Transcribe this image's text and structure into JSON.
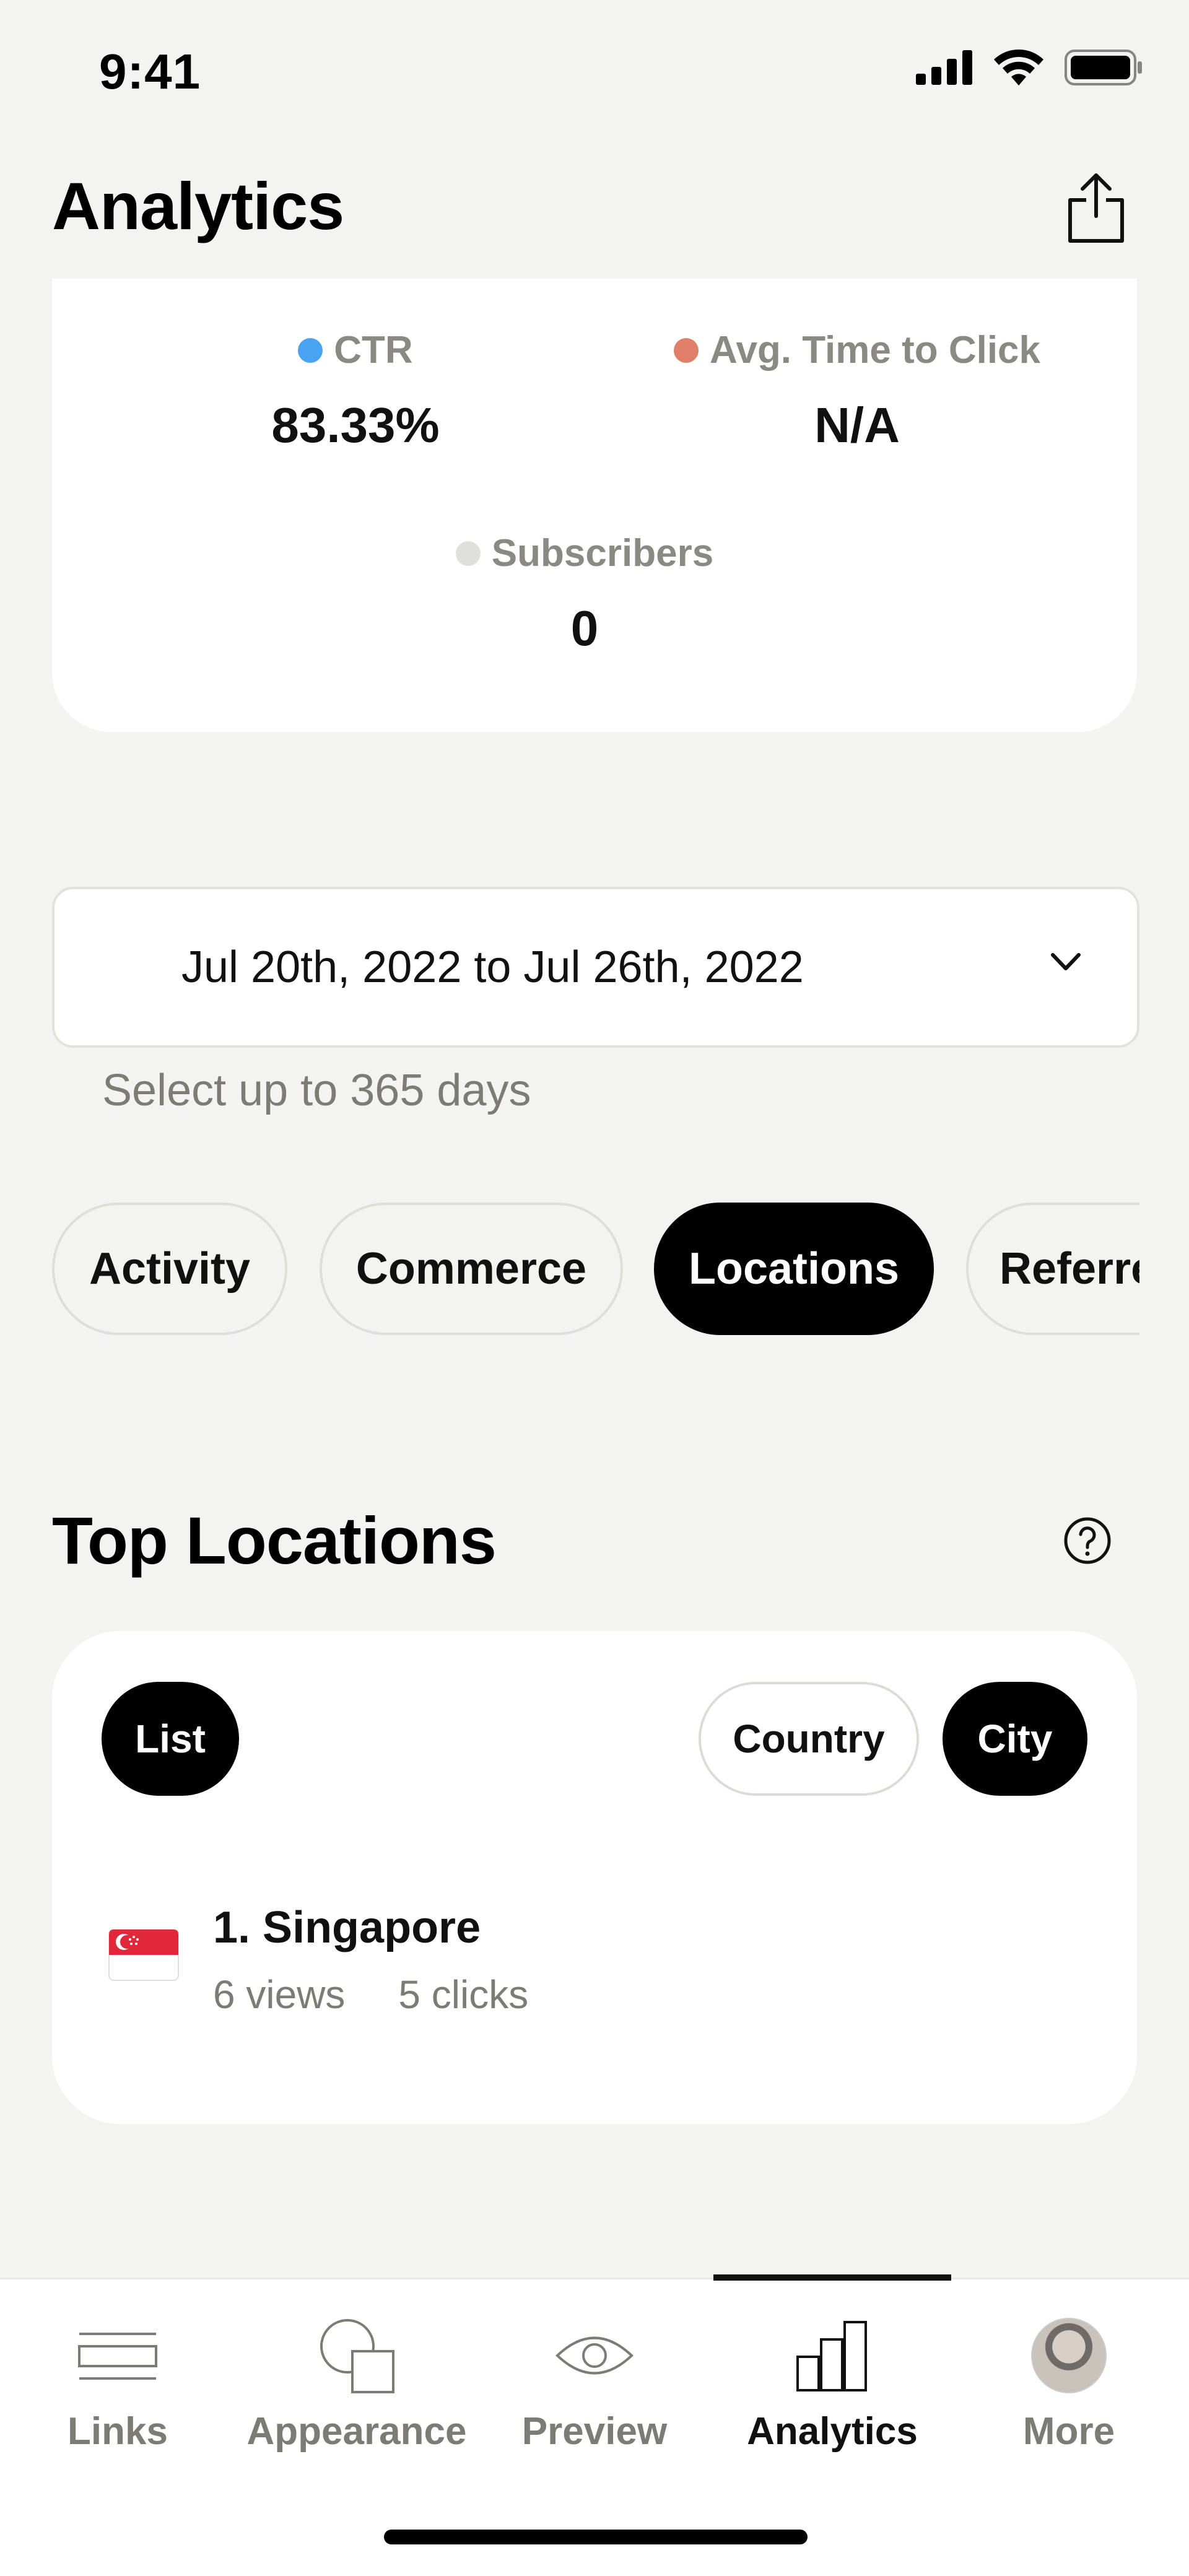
{
  "status_bar": {
    "time": "9:41"
  },
  "header": {
    "title": "Analytics"
  },
  "stats": {
    "ctr": {
      "label": "CTR",
      "value": "83.33%",
      "color": "#4aa3f0"
    },
    "avg_time": {
      "label": "Avg. Time to Click",
      "value": "N/A",
      "color": "#e0806a"
    },
    "subscribers": {
      "label": "Subscribers",
      "value": "0",
      "color": "#e0e0da"
    }
  },
  "date_range": {
    "value": "Jul 20th, 2022 to Jul 26th, 2022",
    "hint": "Select up to 365 days"
  },
  "tabs": [
    {
      "label": "Activity",
      "active": false
    },
    {
      "label": "Commerce",
      "active": false
    },
    {
      "label": "Locations",
      "active": true
    },
    {
      "label": "Referrers",
      "active": false
    }
  ],
  "top_locations": {
    "title": "Top Locations",
    "view_toggle": "List",
    "filters": [
      {
        "label": "Country",
        "active": false
      },
      {
        "label": "City",
        "active": true
      }
    ],
    "items": [
      {
        "rank_name": "1. Singapore",
        "views": "6 views",
        "clicks": "5 clicks",
        "flag": "singapore-flag"
      }
    ]
  },
  "bottom_nav": [
    {
      "label": "Links",
      "icon": "links-icon",
      "active": false
    },
    {
      "label": "Appearance",
      "icon": "appearance-icon",
      "active": false
    },
    {
      "label": "Preview",
      "icon": "eye-icon",
      "active": false
    },
    {
      "label": "Analytics",
      "icon": "bar-chart-icon",
      "active": true
    },
    {
      "label": "More",
      "icon": "avatar",
      "active": false
    }
  ]
}
